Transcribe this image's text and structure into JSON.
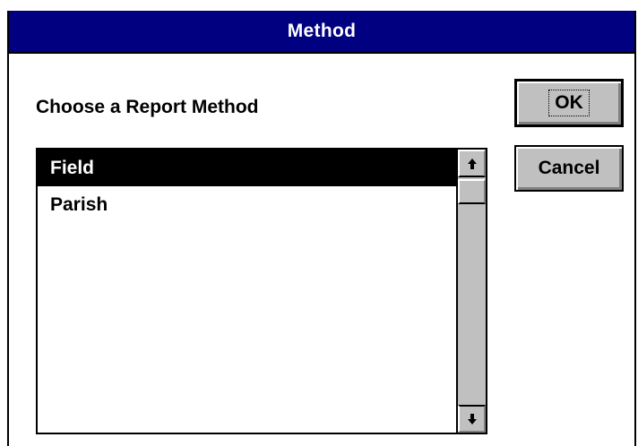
{
  "window": {
    "title": "Method",
    "title_bar_color": "#000080"
  },
  "prompt": "Choose a Report Method",
  "list": {
    "items": [
      {
        "label": "Field",
        "selected": true
      },
      {
        "label": "Parish",
        "selected": false
      }
    ],
    "scroll_up_icon": "arrow-up-icon",
    "scroll_down_icon": "arrow-down-icon"
  },
  "buttons": {
    "ok_label": "OK",
    "cancel_label": "Cancel"
  }
}
